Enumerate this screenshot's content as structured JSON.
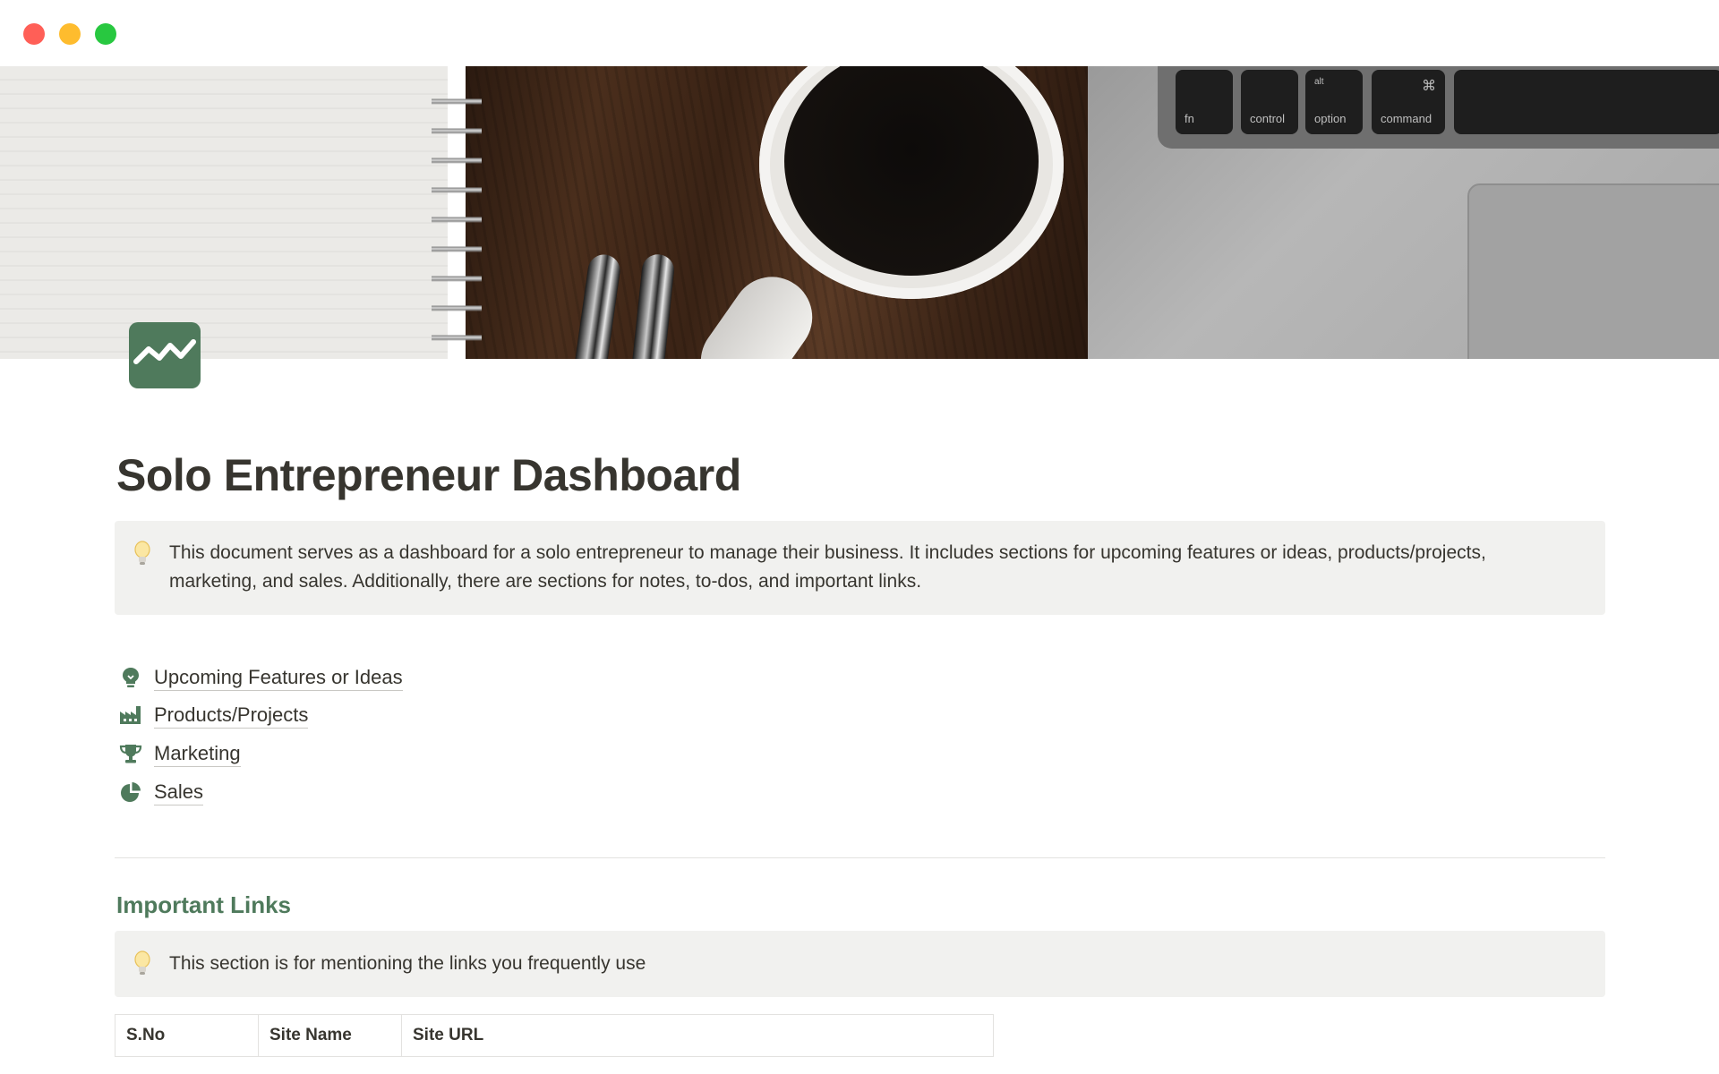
{
  "window": {
    "controls": [
      "close",
      "minimize",
      "maximize"
    ]
  },
  "cover": {
    "keys": {
      "fn": "fn",
      "control": "control",
      "option": "option",
      "option_sup": "alt",
      "command": "command",
      "command_symbol": "⌘"
    }
  },
  "page": {
    "icon": "chart-trending-up-icon",
    "title": "Solo Entrepreneur Dashboard",
    "intro_callout": {
      "icon": "lightbulb-icon",
      "text": "This document serves as a dashboard for a solo entrepreneur to manage their business. It includes sections for upcoming features or ideas, products/projects, marketing, and sales. Additionally, there are sections for notes, to-dos, and important links."
    },
    "links": [
      {
        "label": "Upcoming Features or Ideas",
        "icon": "lightbulb-outline-icon"
      },
      {
        "label": "Products/Projects",
        "icon": "factory-icon"
      },
      {
        "label": "Marketing",
        "icon": "trophy-icon"
      },
      {
        "label": "Sales",
        "icon": "pie-chart-icon"
      }
    ],
    "important_links": {
      "heading": "Important Links",
      "callout": {
        "icon": "lightbulb-icon",
        "text": "This section is for mentioning the links you frequently use"
      },
      "table": {
        "columns": [
          "S.No",
          "Site Name",
          "Site URL"
        ]
      }
    }
  },
  "colors": {
    "accent": "#4f7a5c",
    "text": "#37352f",
    "callout_bg": "#f1f1ef",
    "close": "#ff5f57",
    "minimize": "#febc2e",
    "maximize": "#28c840"
  }
}
